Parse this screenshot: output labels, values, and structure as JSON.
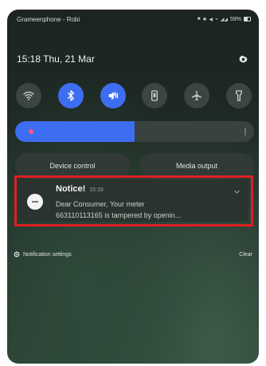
{
  "status_bar": {
    "carrier": "Grameenphone - Robi",
    "battery": "59%"
  },
  "header": {
    "time": "15:18",
    "date": "Thu, 21 Mar"
  },
  "quick_settings": [
    {
      "name": "wifi",
      "active": false
    },
    {
      "name": "bluetooth",
      "active": true
    },
    {
      "name": "sound-mute",
      "active": true
    },
    {
      "name": "auto-rotate",
      "active": false
    },
    {
      "name": "airplane-mode",
      "active": false
    },
    {
      "name": "flashlight",
      "active": false
    }
  ],
  "brightness": {
    "level": 0.5
  },
  "buttons": {
    "device_control": "Device control",
    "media_output": "Media output"
  },
  "notification": {
    "title": "Notice!",
    "time": "15:18",
    "line1": "Dear Consumer, Your meter",
    "line2": "663110113165 is tampered by openin..."
  },
  "footer": {
    "settings_label": "Notification settings",
    "clear_label": "Clear"
  },
  "colors": {
    "accent": "#3d6df0",
    "highlight_border": "#e01e22"
  }
}
